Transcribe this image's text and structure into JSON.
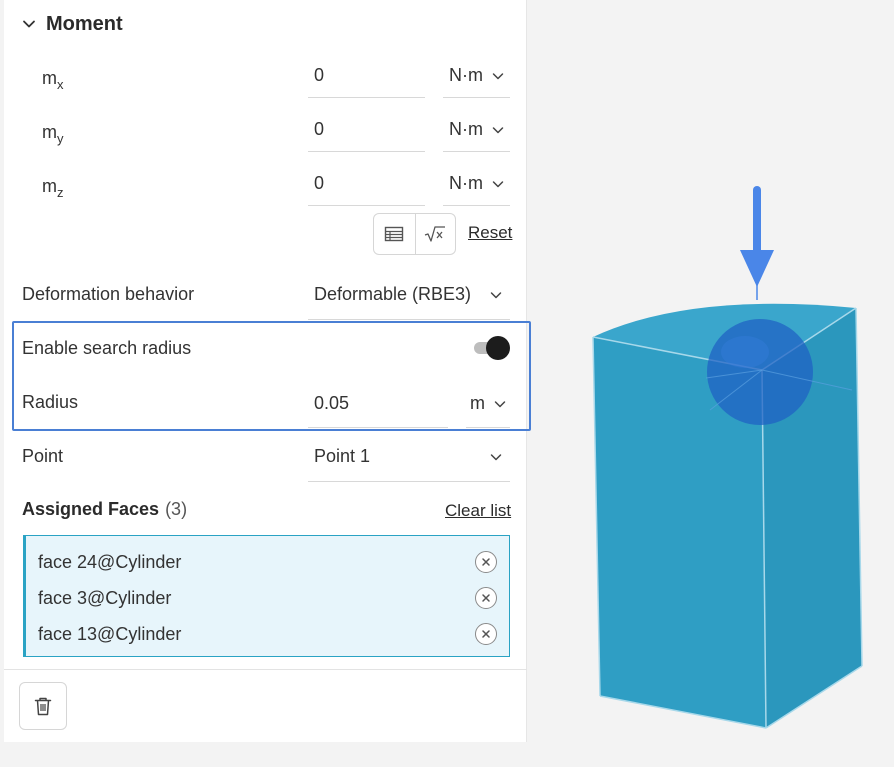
{
  "moment": {
    "title": "Moment",
    "components": [
      {
        "label": "m",
        "sub": "x",
        "value": "0",
        "unit": "N·m"
      },
      {
        "label": "m",
        "sub": "y",
        "value": "0",
        "unit": "N·m"
      },
      {
        "label": "m",
        "sub": "z",
        "value": "0",
        "unit": "N·m"
      }
    ],
    "reset_label": "Reset",
    "icons": [
      "table-icon",
      "formula-icon"
    ]
  },
  "deformation": {
    "label": "Deformation behavior",
    "value": "Deformable (RBE3)"
  },
  "search_radius": {
    "label": "Enable search radius",
    "enabled": true
  },
  "radius": {
    "label": "Radius",
    "value": "0.05",
    "unit": "m"
  },
  "point": {
    "label": "Point",
    "value": "Point 1"
  },
  "assigned_faces": {
    "title": "Assigned Faces",
    "count": "(3)",
    "clear_label": "Clear list",
    "items": [
      "face 24@Cylinder",
      "face 3@Cylinder",
      "face 13@Cylinder"
    ]
  },
  "colors": {
    "accent_blue": "#4a7fd4",
    "face_list_border": "#2aa3c4",
    "face_list_bg": "#e7f5fb",
    "model_fill": "#2f9ec4",
    "arrow": "#4a86e8"
  }
}
